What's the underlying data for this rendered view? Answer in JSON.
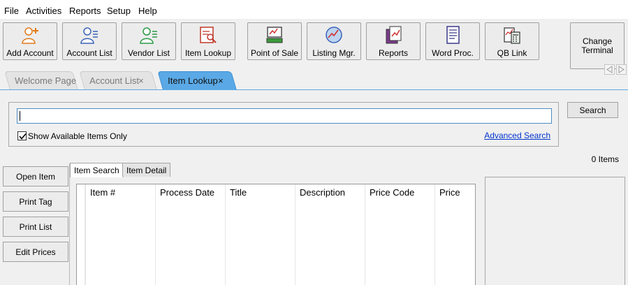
{
  "menu": [
    "File",
    "Activities",
    "Reports",
    "Setup",
    "Help"
  ],
  "toolbar": {
    "buttons": [
      {
        "label": "Add Account",
        "icon": "add-account-icon"
      },
      {
        "label": "Account List",
        "icon": "account-list-icon"
      },
      {
        "label": "Vendor List",
        "icon": "vendor-list-icon"
      },
      {
        "label": "Item Lookup",
        "icon": "item-lookup-icon"
      },
      {
        "label": "Point of Sale",
        "icon": "point-of-sale-icon"
      },
      {
        "label": "Listing Mgr.",
        "icon": "listing-manager-icon"
      },
      {
        "label": "Reports",
        "icon": "reports-icon"
      },
      {
        "label": "Word Proc.",
        "icon": "word-processor-icon"
      },
      {
        "label": "QB Link",
        "icon": "qb-link-icon"
      }
    ],
    "change_terminal": "Change\nTerminal"
  },
  "tabs": [
    {
      "label": "Welcome Page",
      "close": ""
    },
    {
      "label": "Account List",
      "close": "×"
    },
    {
      "label": "Item Lookup",
      "close": "×"
    }
  ],
  "search": {
    "value": "",
    "placeholder": "",
    "checkbox_label": "Show Available Items Only",
    "checked": true,
    "advanced_link": "Advanced Search",
    "button": "Search"
  },
  "item_count": "0 Items",
  "actions": [
    "Open Item",
    "Print Tag",
    "Print List",
    "Edit Prices"
  ],
  "subtabs": [
    "Item Search",
    "Item Detail"
  ],
  "grid": {
    "columns": [
      "Item #",
      "Process Date",
      "Title",
      "Description",
      "Price Code",
      "Price"
    ],
    "rows": []
  },
  "colors": {
    "active_tab": "#5aa9e6",
    "link": "#0033cc"
  }
}
